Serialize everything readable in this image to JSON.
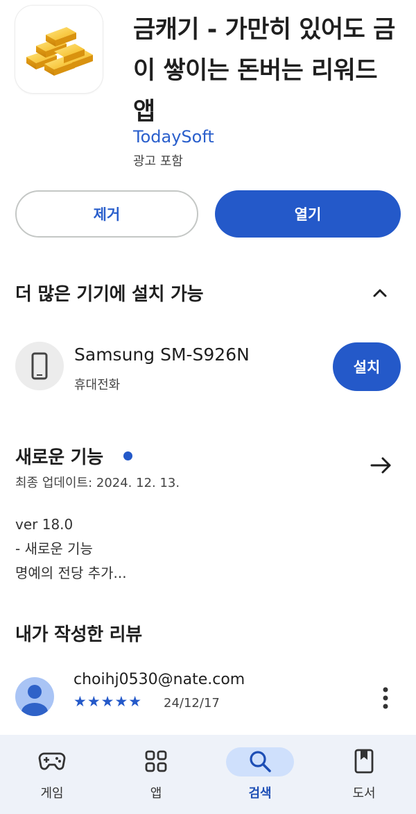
{
  "app": {
    "title": "금캐기 - 가만히 있어도 금이 쌓이는 돈버는 리워드 앱",
    "developer": "TodaySoft",
    "ad_label": "광고 포함",
    "icon": "gold-bars-icon"
  },
  "actions": {
    "remove_label": "제거",
    "open_label": "열기"
  },
  "devices": {
    "section_title": "더 많은 기기에 설치 가능",
    "items": [
      {
        "name": "Samsung SM-S926N",
        "type": "휴대전화",
        "install_label": "설치",
        "icon": "phone-icon"
      }
    ]
  },
  "whats_new": {
    "title": "새로운 기능",
    "updated": "최종 업데이트: 2024. 12. 13.",
    "notes": [
      "ver 18.0",
      "- 새로운 기능",
      "명예의 전당 추가..."
    ]
  },
  "my_review": {
    "section_title": "내가 작성한 리뷰",
    "reviewer": "choihj0530@nate.com",
    "rating": 5,
    "stars": "★★★★★",
    "date": "24/12/17"
  },
  "bottom_nav": {
    "items": [
      {
        "label": "게임",
        "icon": "gamepad-icon",
        "active": false
      },
      {
        "label": "앱",
        "icon": "apps-grid-icon",
        "active": false
      },
      {
        "label": "검색",
        "icon": "search-icon",
        "active": true
      },
      {
        "label": "도서",
        "icon": "book-icon",
        "active": false
      }
    ]
  },
  "colors": {
    "accent": "#2459c9",
    "nav_background": "#eef2f9",
    "active_pill": "#cfe0fc",
    "gold": "#f2b51c"
  }
}
